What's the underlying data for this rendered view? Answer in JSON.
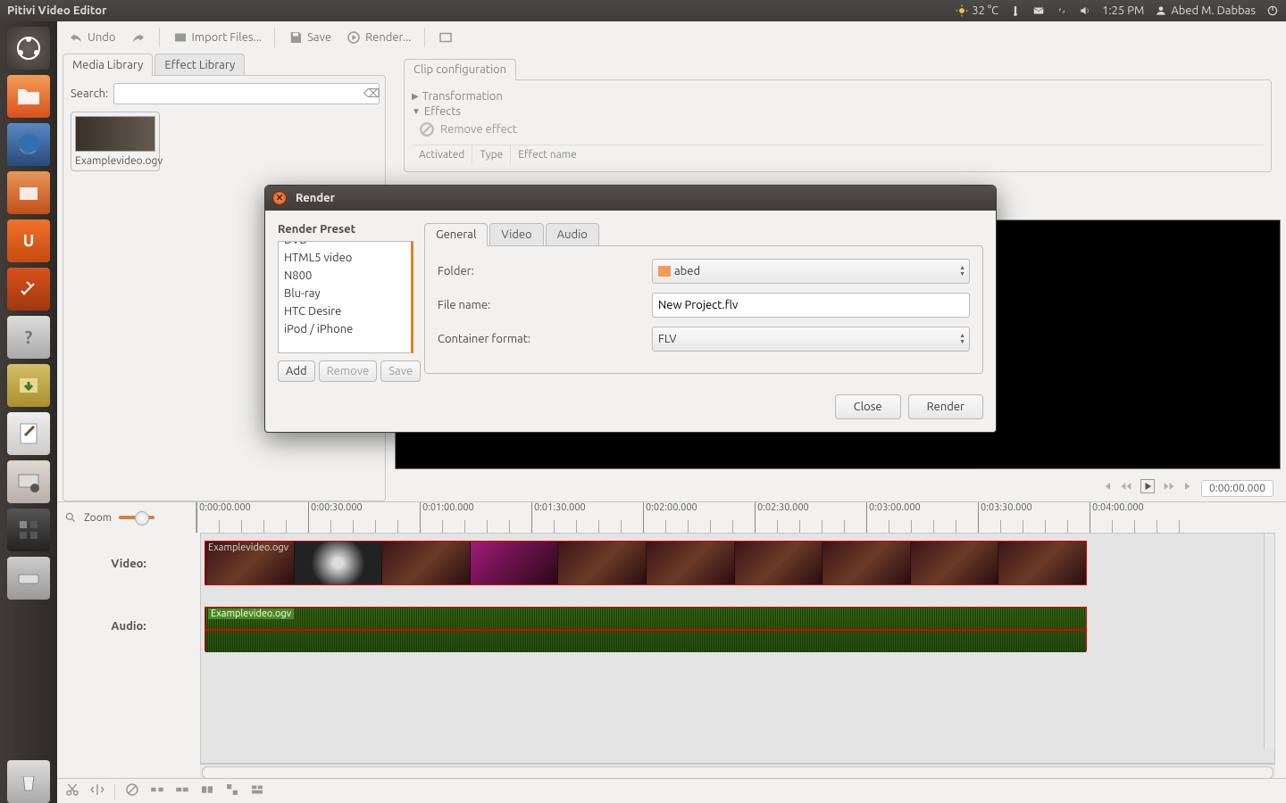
{
  "topbar": {
    "app_title": "Pitivi Video Editor",
    "temp": "32 °C",
    "time": "1:25 PM",
    "user": "Abed M. Dabbas"
  },
  "toolbar": {
    "undo": "Undo",
    "import": "Import Files...",
    "save": "Save",
    "render": "Render..."
  },
  "tabs": {
    "media": "Media Library",
    "effect": "Effect Library",
    "search": "Search:"
  },
  "media": {
    "item_name": "Examplevideo.ogv"
  },
  "clip": {
    "title": "Clip configuration",
    "transformation": "Transformation",
    "effects": "Effects",
    "remove": "Remove effect",
    "col_act": "Activated",
    "col_type": "Type",
    "col_name": "Effect name"
  },
  "transport": {
    "timecode": "0:00:00.000"
  },
  "timeline": {
    "zoom": "Zoom",
    "video_label": "Video:",
    "audio_label": "Audio:",
    "marks": [
      "0:00:00.000",
      "0:00:30.000",
      "0:01:00.000",
      "0:01:30.000",
      "0:02:00.000",
      "0:02:30.000",
      "0:03:00.000",
      "0:03:30.000",
      "0:04:00.000"
    ],
    "video_clip": "Examplevideo.ogv",
    "audio_clip": "Examplevideo.ogv"
  },
  "dialog": {
    "title": "Render",
    "preset_label": "Render Preset",
    "presets": [
      "DVD",
      "HTML5 video",
      "N800",
      "Blu-ray",
      "HTC Desire",
      "iPod / iPhone"
    ],
    "add": "Add",
    "remove": "Remove",
    "save": "Save",
    "tabs": {
      "general": "General",
      "video": "Video",
      "audio": "Audio"
    },
    "folder_label": "Folder:",
    "folder_value": "abed",
    "filename_label": "File name:",
    "filename_value": "New Project.flv",
    "container_label": "Container format:",
    "container_value": "FLV",
    "close": "Close",
    "render": "Render"
  }
}
